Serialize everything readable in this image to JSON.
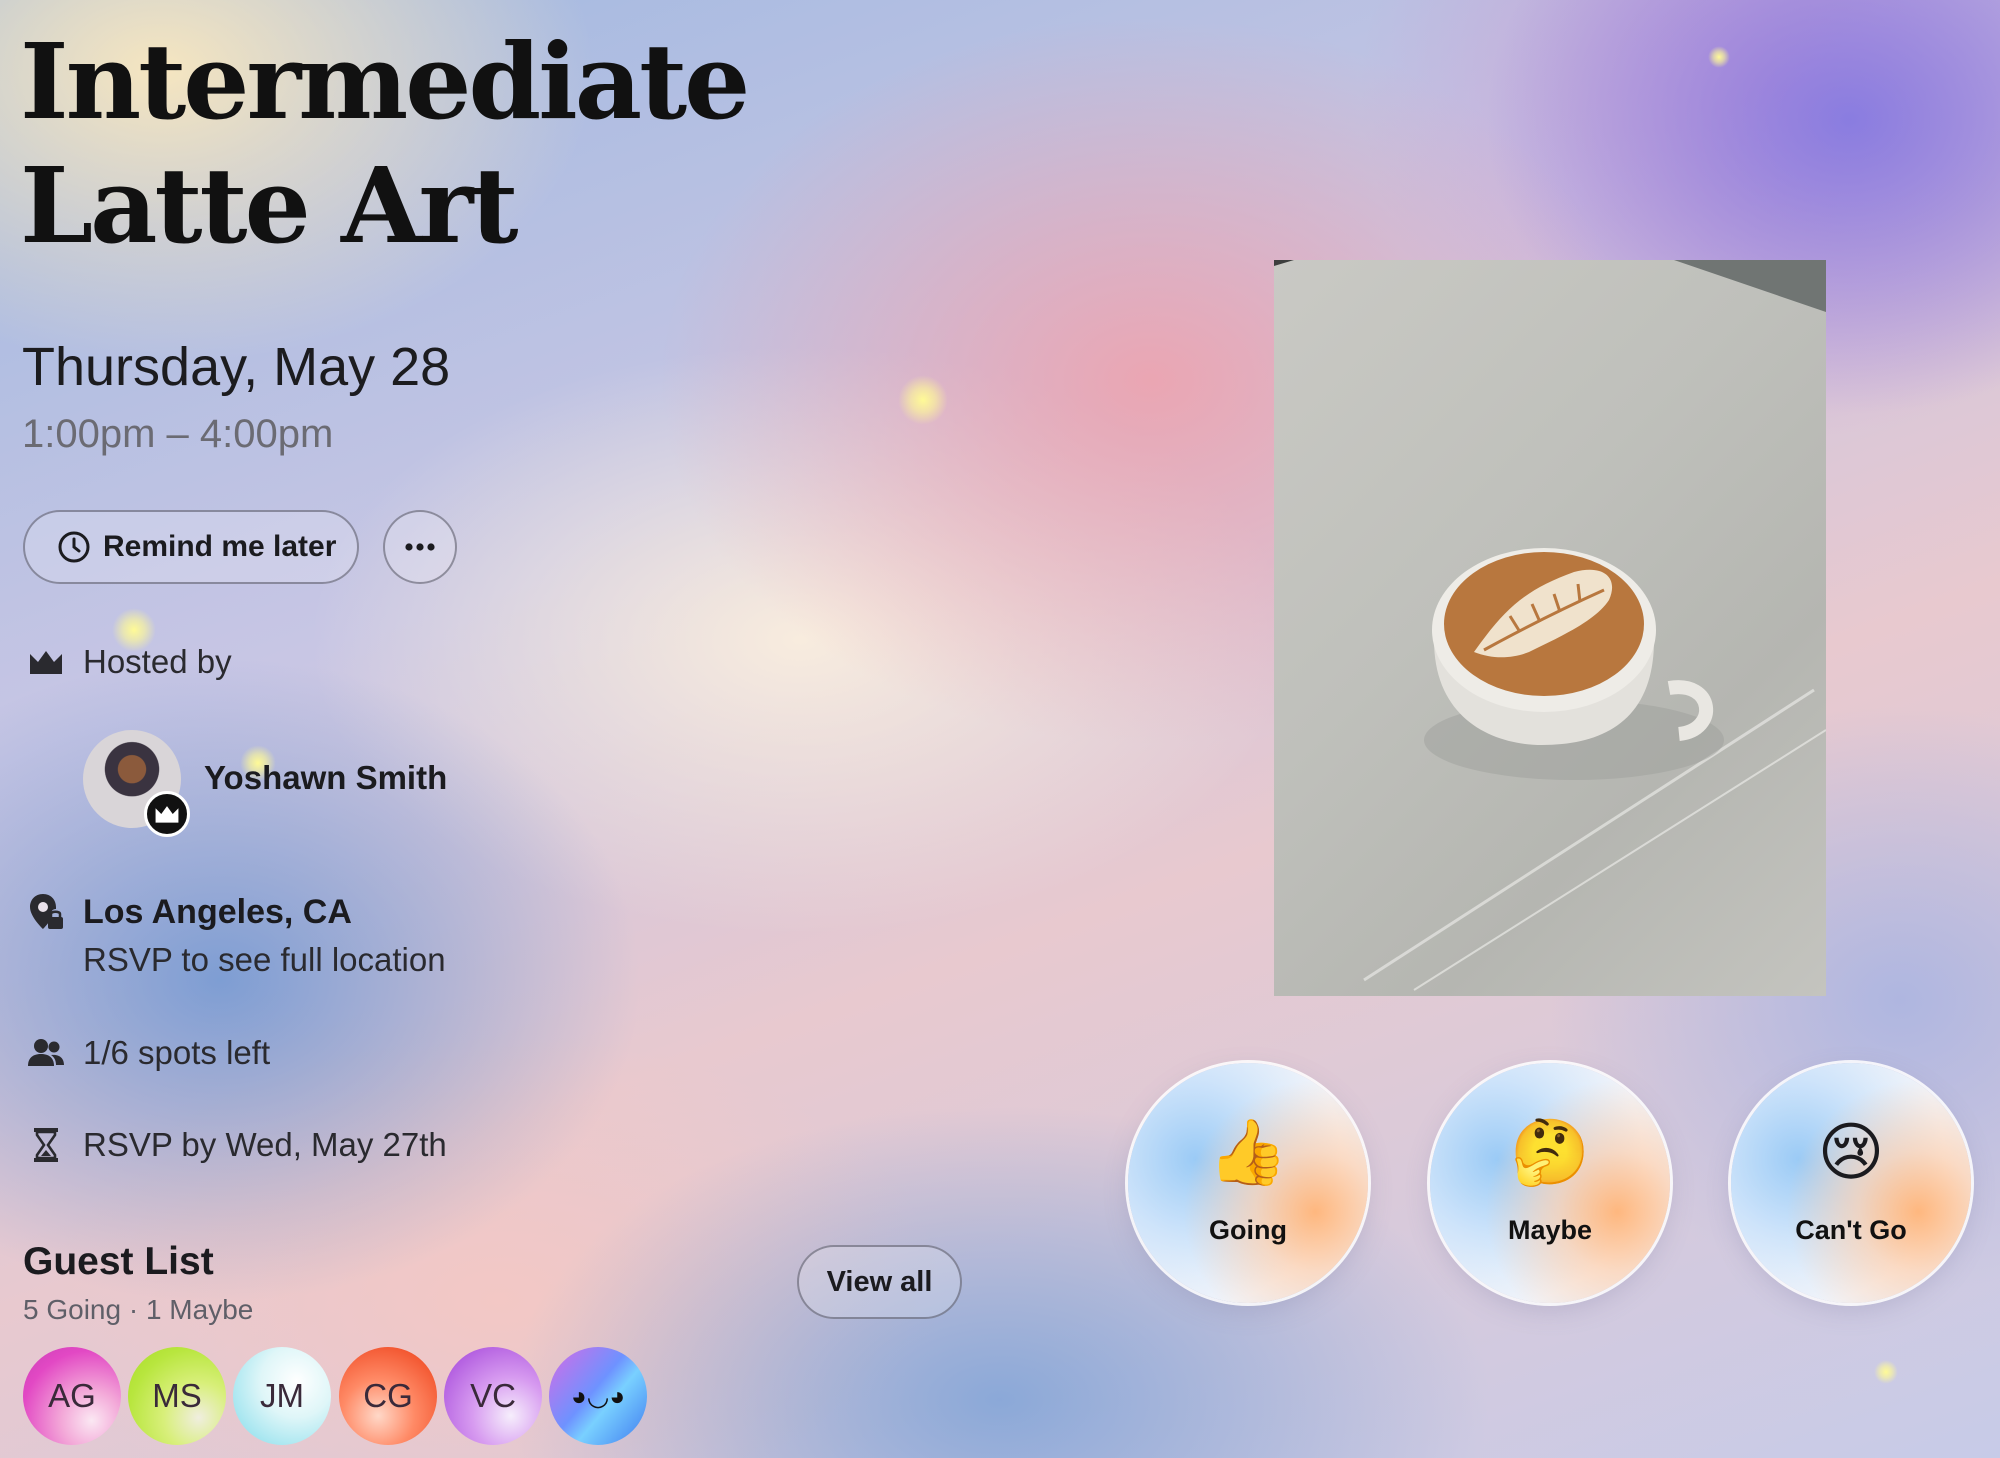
{
  "event": {
    "title": "Intermediate Latte Art",
    "date": "Thursday, May 28",
    "time": "1:00pm – 4:00pm"
  },
  "actions": {
    "remind_label": "Remind me later",
    "more_label": "•••"
  },
  "host": {
    "heading": "Hosted by",
    "name": "Yoshawn Smith"
  },
  "location": {
    "city": "Los Angeles, CA",
    "note": "RSVP to see full location"
  },
  "spots": "1/6 spots left",
  "deadline": "RSVP by Wed, May 27th",
  "guest_list": {
    "title": "Guest List",
    "summary": "5 Going · 1 Maybe",
    "view_all_label": "View all",
    "guests": [
      {
        "initials": "AG"
      },
      {
        "initials": "MS"
      },
      {
        "initials": "JM"
      },
      {
        "initials": "CG"
      },
      {
        "initials": "VC"
      },
      {
        "initials": "◕◡◕"
      }
    ]
  },
  "rsvp_options": [
    {
      "emoji": "👍",
      "label": "Going"
    },
    {
      "emoji": "🤔",
      "label": "Maybe"
    },
    {
      "emoji": "😢",
      "label": "Can't Go"
    }
  ],
  "icons": {
    "clock": "clock-icon",
    "more": "more-icon",
    "crown": "crown-icon",
    "location": "location-lock-icon",
    "people": "people-icon",
    "hourglass": "hourglass-icon"
  }
}
